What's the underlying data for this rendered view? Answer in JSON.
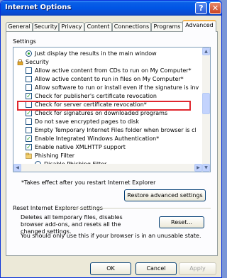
{
  "window": {
    "title": "Internet Options",
    "help_glyph": "?",
    "close_glyph": "✕"
  },
  "tabs": [
    "General",
    "Security",
    "Privacy",
    "Content",
    "Connections",
    "Programs",
    "Advanced"
  ],
  "settings": {
    "group_label": "Settings",
    "items": [
      {
        "kind": "radio",
        "checked": true,
        "label": "Just display the results in the main window"
      },
      {
        "kind": "folder",
        "label": "Security"
      },
      {
        "kind": "check",
        "checked": false,
        "label": "Allow active content from CDs to run on My Computer*"
      },
      {
        "kind": "check",
        "checked": false,
        "label": "Allow active content to run in files on My Computer*"
      },
      {
        "kind": "check",
        "checked": false,
        "label": "Allow software to run or install even if the signature is inv"
      },
      {
        "kind": "check",
        "checked": true,
        "label": "Check for publisher's certificate revocation"
      },
      {
        "kind": "check",
        "checked": false,
        "label": "Check for server certificate revocation*"
      },
      {
        "kind": "check",
        "checked": true,
        "label": "Check for signatures on downloaded programs"
      },
      {
        "kind": "check",
        "checked": false,
        "label": "Do not save encrypted pages to disk"
      },
      {
        "kind": "check",
        "checked": false,
        "label": "Empty Temporary Internet Files folder when browser is cl"
      },
      {
        "kind": "check",
        "checked": true,
        "label": "Enable Integrated Windows Authentication*"
      },
      {
        "kind": "check",
        "checked": true,
        "label": "Enable native XMLHTTP support"
      },
      {
        "kind": "folder",
        "label": "Phishing Filter"
      },
      {
        "kind": "radio",
        "checked": false,
        "label": "Disable Phishing Filter"
      }
    ],
    "note": "*Takes effect after you restart Internet Explorer",
    "restore_button": "Restore advanced settings"
  },
  "reset": {
    "group_label": "Reset Internet Explorer settings",
    "description": "Deletes all temporary files, disables browser add-ons, and resets all the changed settings.",
    "button": "Reset...",
    "warning": "You should only use this if your browser is in an unusable state."
  },
  "footer": {
    "ok": "OK",
    "cancel": "Cancel",
    "apply": "Apply"
  },
  "colors": {
    "title_bar": "#0055e5",
    "highlight_box": "#e0262e",
    "check_mark": "#21a121"
  }
}
